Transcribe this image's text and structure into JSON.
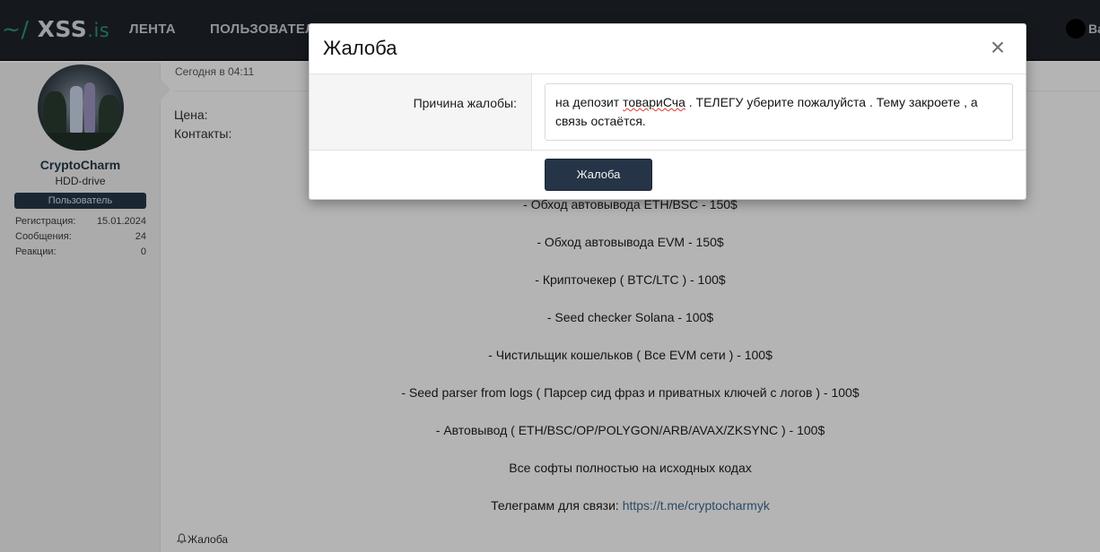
{
  "header": {
    "logo_tilde": "~/",
    "logo_name": "XSS",
    "logo_tld": ".is",
    "nav": [
      {
        "label": "ЛЕНТА"
      },
      {
        "label": "ПОЛЬЗОВАТЕЛ"
      }
    ],
    "user_label": "Ba"
  },
  "post": {
    "user": {
      "name": "CryptoCharm",
      "title": "HDD-drive",
      "badge": "Пользователь",
      "stats": [
        {
          "label": "Регистрация:",
          "value": "15.01.2024"
        },
        {
          "label": "Сообщения:",
          "value": "24"
        },
        {
          "label": "Реакции:",
          "value": "0"
        }
      ]
    },
    "date": "Сегодня в 04:11",
    "fields": {
      "price_label": "Цена:",
      "contacts_label": "Контакты:"
    },
    "lines": [
      "- Обход автовывода ETH/BSC - 150$",
      "- Обход автовывода EVM - 150$",
      "- Крипточекер ( BTC/LTC ) - 100$",
      "- Seed checker Solana - 100$",
      "- Чистильщик кошельков ( Все EVM сети ) - 100$",
      "- Seed parser from logs ( Парсер сид фраз и приватных ключей с логов ) - 100$",
      "- Автовывод ( ETH/BSC/OP/POLYGON/ARB/AVAX/ZKSYNC ) - 100$",
      "Все софты полностью на исходных кодах"
    ],
    "contact_prefix": "Телеграмм для связи: ",
    "contact_link": "https://t.me/cryptocharmyk",
    "report_link": "Жалоба"
  },
  "modal": {
    "title": "Жалоба",
    "close_glyph": "×",
    "reason_label": "Причина жалобы:",
    "reason_text_before": "на депозит ",
    "reason_text_misspelled": "товариСча",
    "reason_text_after": " . ТЕЛЕГУ уберите пожалуйста . Тему закроете , а связь остаётся.",
    "submit_label": "Жалоба"
  }
}
